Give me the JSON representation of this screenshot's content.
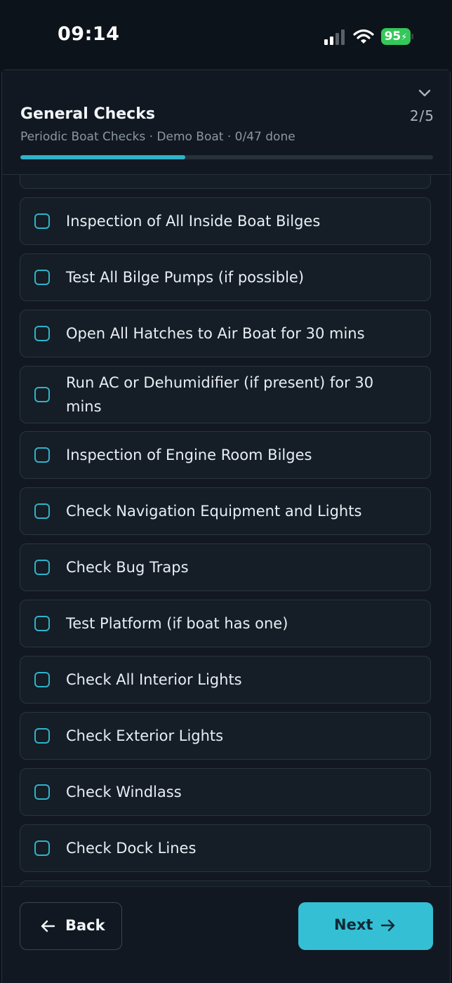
{
  "status_bar": {
    "time": "09:14",
    "battery": "95"
  },
  "header": {
    "title": "General Checks",
    "step": "2/5",
    "subtitle": "Periodic Boat Checks · Demo Boat · 0/47 done",
    "progress_percent": 40
  },
  "checklist": {
    "items": [
      {
        "label": "Inspection of All Inside Boat Bilges",
        "checked": false
      },
      {
        "label": "Test All Bilge Pumps (if possible)",
        "checked": false
      },
      {
        "label": "Open All Hatches to Air Boat for 30 mins",
        "checked": false
      },
      {
        "label": "Run AC or Dehumidifier (if present) for 30 mins",
        "checked": false
      },
      {
        "label": "Inspection of Engine Room Bilges",
        "checked": false
      },
      {
        "label": "Check Navigation Equipment and Lights",
        "checked": false
      },
      {
        "label": "Check Bug Traps",
        "checked": false
      },
      {
        "label": "Test Platform (if boat has one)",
        "checked": false
      },
      {
        "label": "Check All Interior Lights",
        "checked": false
      },
      {
        "label": "Check Exterior Lights",
        "checked": false
      },
      {
        "label": "Check Windlass",
        "checked": false
      },
      {
        "label": "Check Dock Lines",
        "checked": false
      }
    ]
  },
  "footer": {
    "back_label": "Back",
    "next_label": "Next"
  },
  "colors": {
    "accent": "#2fb3c9",
    "next_button": "#35bfd4",
    "background": "#0d131a",
    "card": "#151d26"
  }
}
